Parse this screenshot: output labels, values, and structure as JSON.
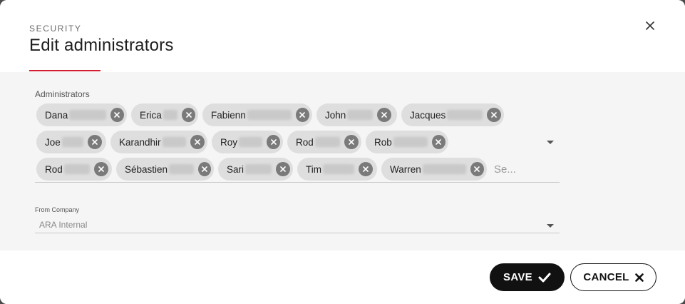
{
  "dialog": {
    "kicker": "SECURITY",
    "title": "Edit administrators"
  },
  "administrators": {
    "label": "Administrators",
    "chips": [
      {
        "name": "Dana"
      },
      {
        "name": "Erica"
      },
      {
        "name": "Fabienn"
      },
      {
        "name": "John"
      },
      {
        "name": "Jacques"
      },
      {
        "name": "Joe"
      },
      {
        "name": "Karandhir"
      },
      {
        "name": "Roy"
      },
      {
        "name": "Rod"
      },
      {
        "name": "Rob"
      },
      {
        "name": "Rod"
      },
      {
        "name": "Sébastien"
      },
      {
        "name": "Sari"
      },
      {
        "name": "Tim"
      },
      {
        "name": "Warren"
      }
    ],
    "search_placeholder": "Se..."
  },
  "company": {
    "label": "From Company",
    "value": "ARA Internal"
  },
  "footer": {
    "save_label": "SAVE",
    "cancel_label": "CANCEL"
  },
  "icons": {
    "close": "close-icon",
    "chip_remove": "cancel-circle-icon",
    "dropdown": "caret-down-icon",
    "save": "checkmark-icon",
    "cancel": "x-icon"
  },
  "colors": {
    "accent": "#d0202e",
    "chip_bg": "#dedede",
    "primary_button": "#111111",
    "body_bg": "#f5f5f5"
  }
}
